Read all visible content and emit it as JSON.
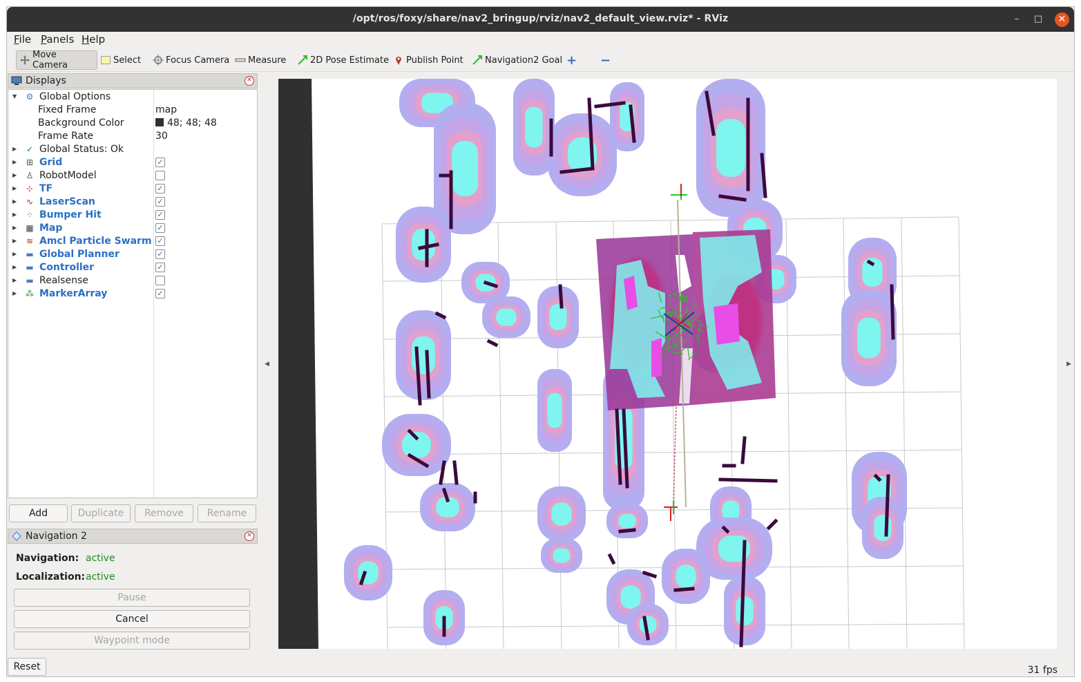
{
  "window": {
    "title": "/opt/ros/foxy/share/nav2_bringup/rviz/nav2_default_view.rviz* - RViz",
    "minimize_glyph": "–",
    "maximize_glyph": "□",
    "close_glyph": "✕"
  },
  "menu": [
    {
      "key": "F",
      "rest": "ile"
    },
    {
      "key": "P",
      "rest": "anels"
    },
    {
      "key": "H",
      "rest": "elp"
    }
  ],
  "toolbar": {
    "move_camera": "Move Camera",
    "select": "Select",
    "focus_camera": "Focus Camera",
    "measure": "Measure",
    "pose_estimate": "2D Pose Estimate",
    "publish_point": "Publish Point",
    "nav_goal": "Navigation2 Goal",
    "add_tool": "+",
    "remove_tool": "−"
  },
  "displays": {
    "title": "Displays",
    "global_options": "Global Options",
    "fixed_frame_label": "Fixed Frame",
    "fixed_frame_value": "map",
    "bg_color_label": "Background Color",
    "bg_color_value": "48; 48; 48",
    "frame_rate_label": "Frame Rate",
    "frame_rate_value": "30",
    "global_status": "Global Status: Ok",
    "items": [
      {
        "label": "Grid",
        "checked": true,
        "blue": true,
        "icon": "grid-icon"
      },
      {
        "label": "RobotModel",
        "checked": false,
        "blue": false,
        "icon": "robot-icon"
      },
      {
        "label": "TF",
        "checked": true,
        "blue": true,
        "icon": "axes-icon"
      },
      {
        "label": "LaserScan",
        "checked": true,
        "blue": true,
        "icon": "laser-icon"
      },
      {
        "label": "Bumper Hit",
        "checked": true,
        "blue": true,
        "icon": "points-icon"
      },
      {
        "label": "Map",
        "checked": true,
        "blue": true,
        "icon": "map-icon"
      },
      {
        "label": "Amcl Particle Swarm",
        "checked": true,
        "blue": true,
        "icon": "pose-array-icon"
      },
      {
        "label": "Global Planner",
        "checked": true,
        "blue": true,
        "icon": "folder-icon"
      },
      {
        "label": "Controller",
        "checked": true,
        "blue": true,
        "icon": "folder-icon"
      },
      {
        "label": "Realsense",
        "checked": false,
        "blue": false,
        "icon": "folder-icon"
      },
      {
        "label": "MarkerArray",
        "checked": true,
        "blue": true,
        "icon": "markers-icon"
      }
    ],
    "buttons": {
      "add": "Add",
      "duplicate": "Duplicate",
      "remove": "Remove",
      "rename": "Rename"
    }
  },
  "navigation": {
    "title": "Navigation 2",
    "nav_label": "Navigation:",
    "nav_value": "active",
    "loc_label": "Localization:",
    "loc_value": "active",
    "pause": "Pause",
    "cancel": "Cancel",
    "waypoint": "Waypoint mode"
  },
  "footer": {
    "reset": "Reset",
    "fps": "31 fps"
  },
  "colors": {
    "costmap_outer": "#b3aef0",
    "costmap_mid": "#c6a3e6",
    "costmap_inner": "#e7a0c8",
    "inflated": "#7ff5f0",
    "obstacle": "#3b0a3b",
    "local_costmap": "#9b3a9a",
    "local_hot": "#c81e6e",
    "checkbox": "#2a6fc4",
    "status_ok": "#1f8a1f"
  }
}
